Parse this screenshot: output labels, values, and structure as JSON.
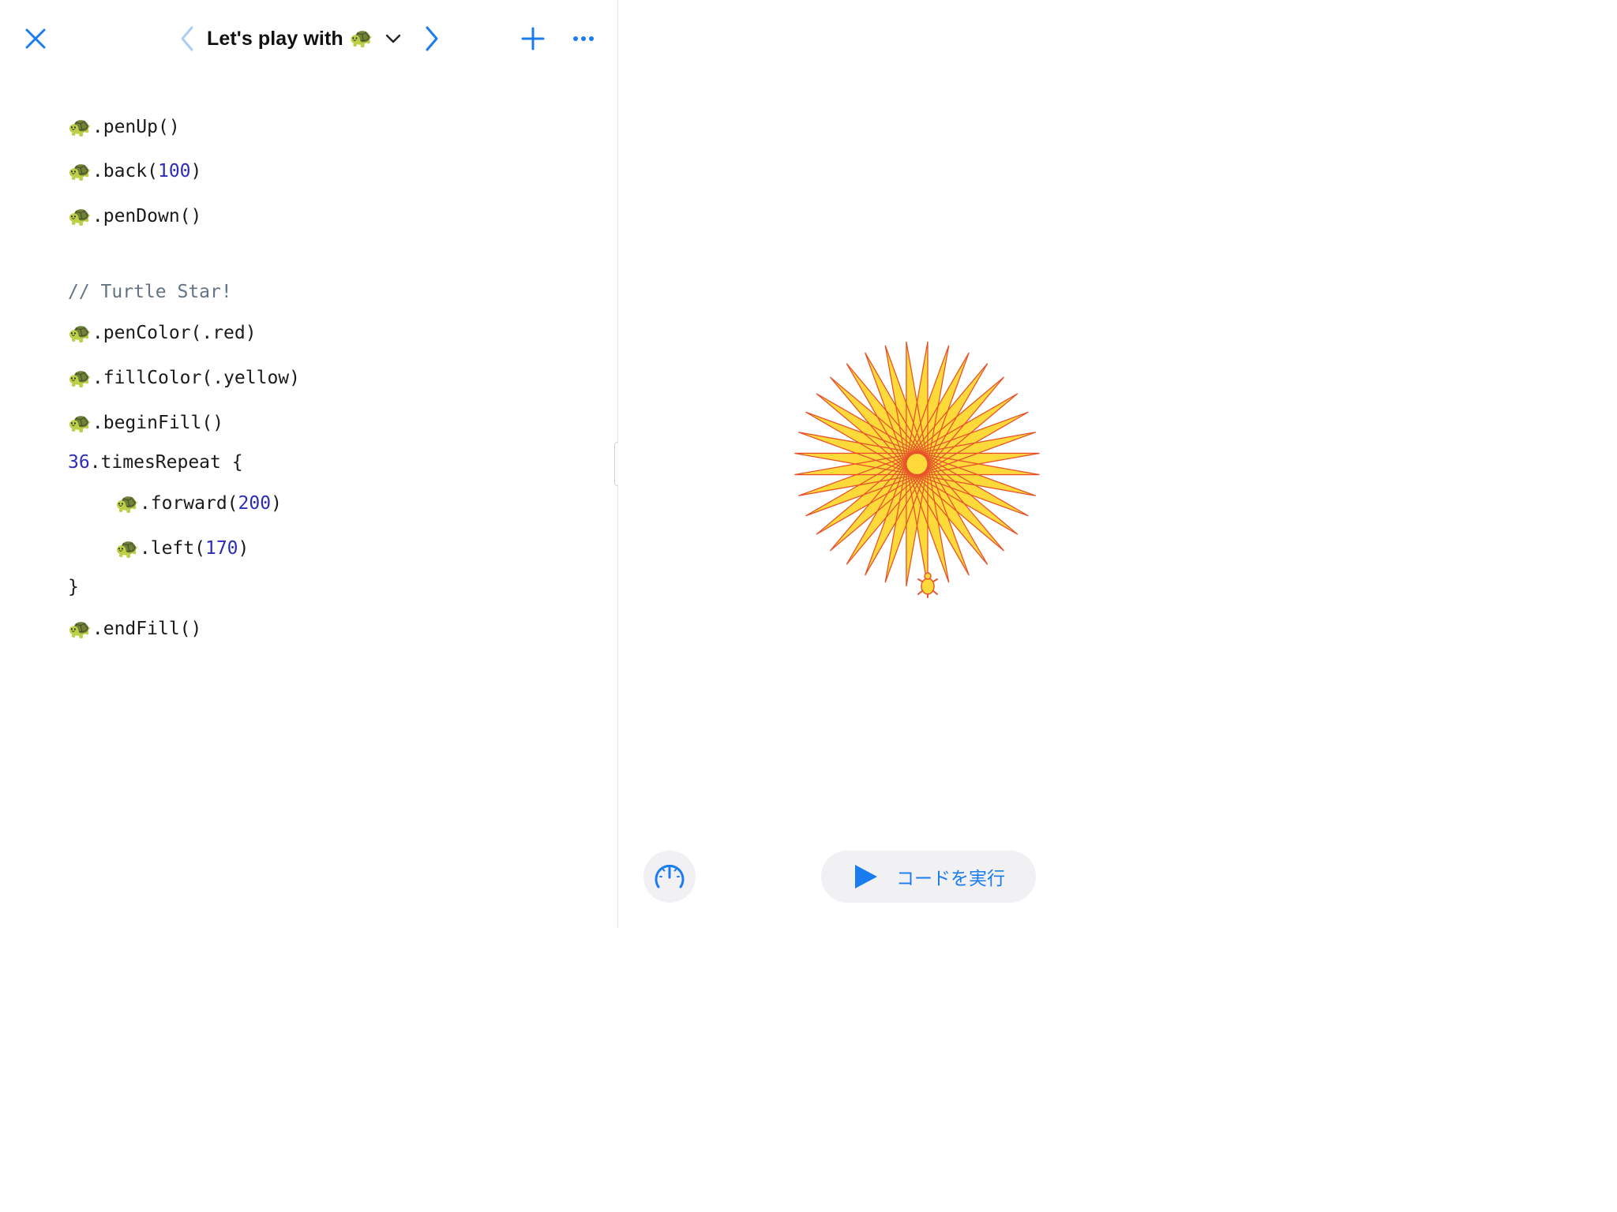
{
  "toolbar": {
    "title": "Let's play with",
    "title_emoji": "🐢",
    "close_icon": "close-icon",
    "prev_icon": "chevron-left-icon",
    "next_icon": "chevron-right-icon",
    "dropdown_icon": "chevron-down-icon",
    "add_icon": "plus-icon",
    "more_icon": "ellipsis-icon"
  },
  "code": {
    "turtle": "🐢",
    "lines": {
      "l1": ".penUp()",
      "l2_pre": ".back(",
      "l2_num": "100",
      "l2_post": ")",
      "l3": ".penDown()",
      "comment": "// Turtle Star!",
      "l5": ".penColor(.red)",
      "l6": ".fillColor(.yellow)",
      "l7": ".beginFill()",
      "l8_num": "36",
      "l8_rest": ".timesRepeat {",
      "l9_pre": ".forward(",
      "l9_num": "200",
      "l9_post": ")",
      "l10_pre": ".left(",
      "l10_num": "170",
      "l10_post": ")",
      "l11": "}",
      "l12": ".endFill()"
    }
  },
  "liveview": {
    "star": {
      "repeat": 36,
      "forward": 200,
      "turn": 170,
      "stroke_color": "#e8542a",
      "fill_color": "#fdda3a"
    },
    "run_label": "コードを実行",
    "run_icon": "play-icon",
    "speed_icon": "speedometer-icon"
  },
  "colors": {
    "accent": "#1b7cf0",
    "number": "#2d2cb8",
    "comment": "#637384"
  }
}
